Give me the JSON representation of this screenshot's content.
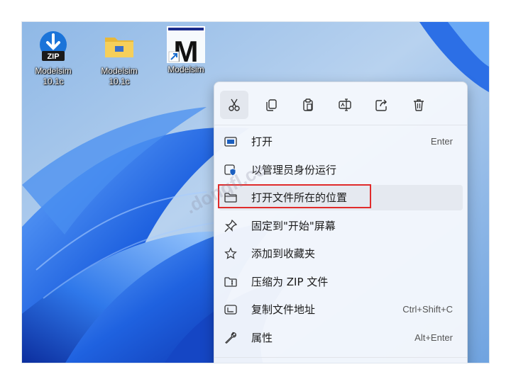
{
  "desktop": {
    "icons": [
      {
        "label": "Modelsim\n10.1c"
      },
      {
        "label": "Modelsim\n10.1c"
      },
      {
        "label": "Modelsim"
      }
    ],
    "zip_badge": "ZIP",
    "m_letter": "M"
  },
  "quick_actions": [
    "cut-icon",
    "copy-icon",
    "paste-icon",
    "rename-icon",
    "share-icon",
    "delete-icon"
  ],
  "menu": {
    "items": [
      {
        "label": "打开",
        "shortcut": "Enter"
      },
      {
        "label": "以管理员身份运行",
        "shortcut": ""
      },
      {
        "label": "打开文件所在的位置",
        "shortcut": ""
      },
      {
        "label": "固定到\"开始\"屏幕",
        "shortcut": ""
      },
      {
        "label": "添加到收藏夹",
        "shortcut": ""
      },
      {
        "label": "压缩为 ZIP 文件",
        "shortcut": ""
      },
      {
        "label": "复制文件地址",
        "shortcut": "Ctrl+Shift+C"
      },
      {
        "label": "属性",
        "shortcut": "Alt+Enter"
      }
    ]
  },
  "watermark": ".dongfl.ce",
  "colors": {
    "accent": "#0067c0",
    "highlight_border": "#e02b2b",
    "wallpaper": "#1a5bd6"
  }
}
